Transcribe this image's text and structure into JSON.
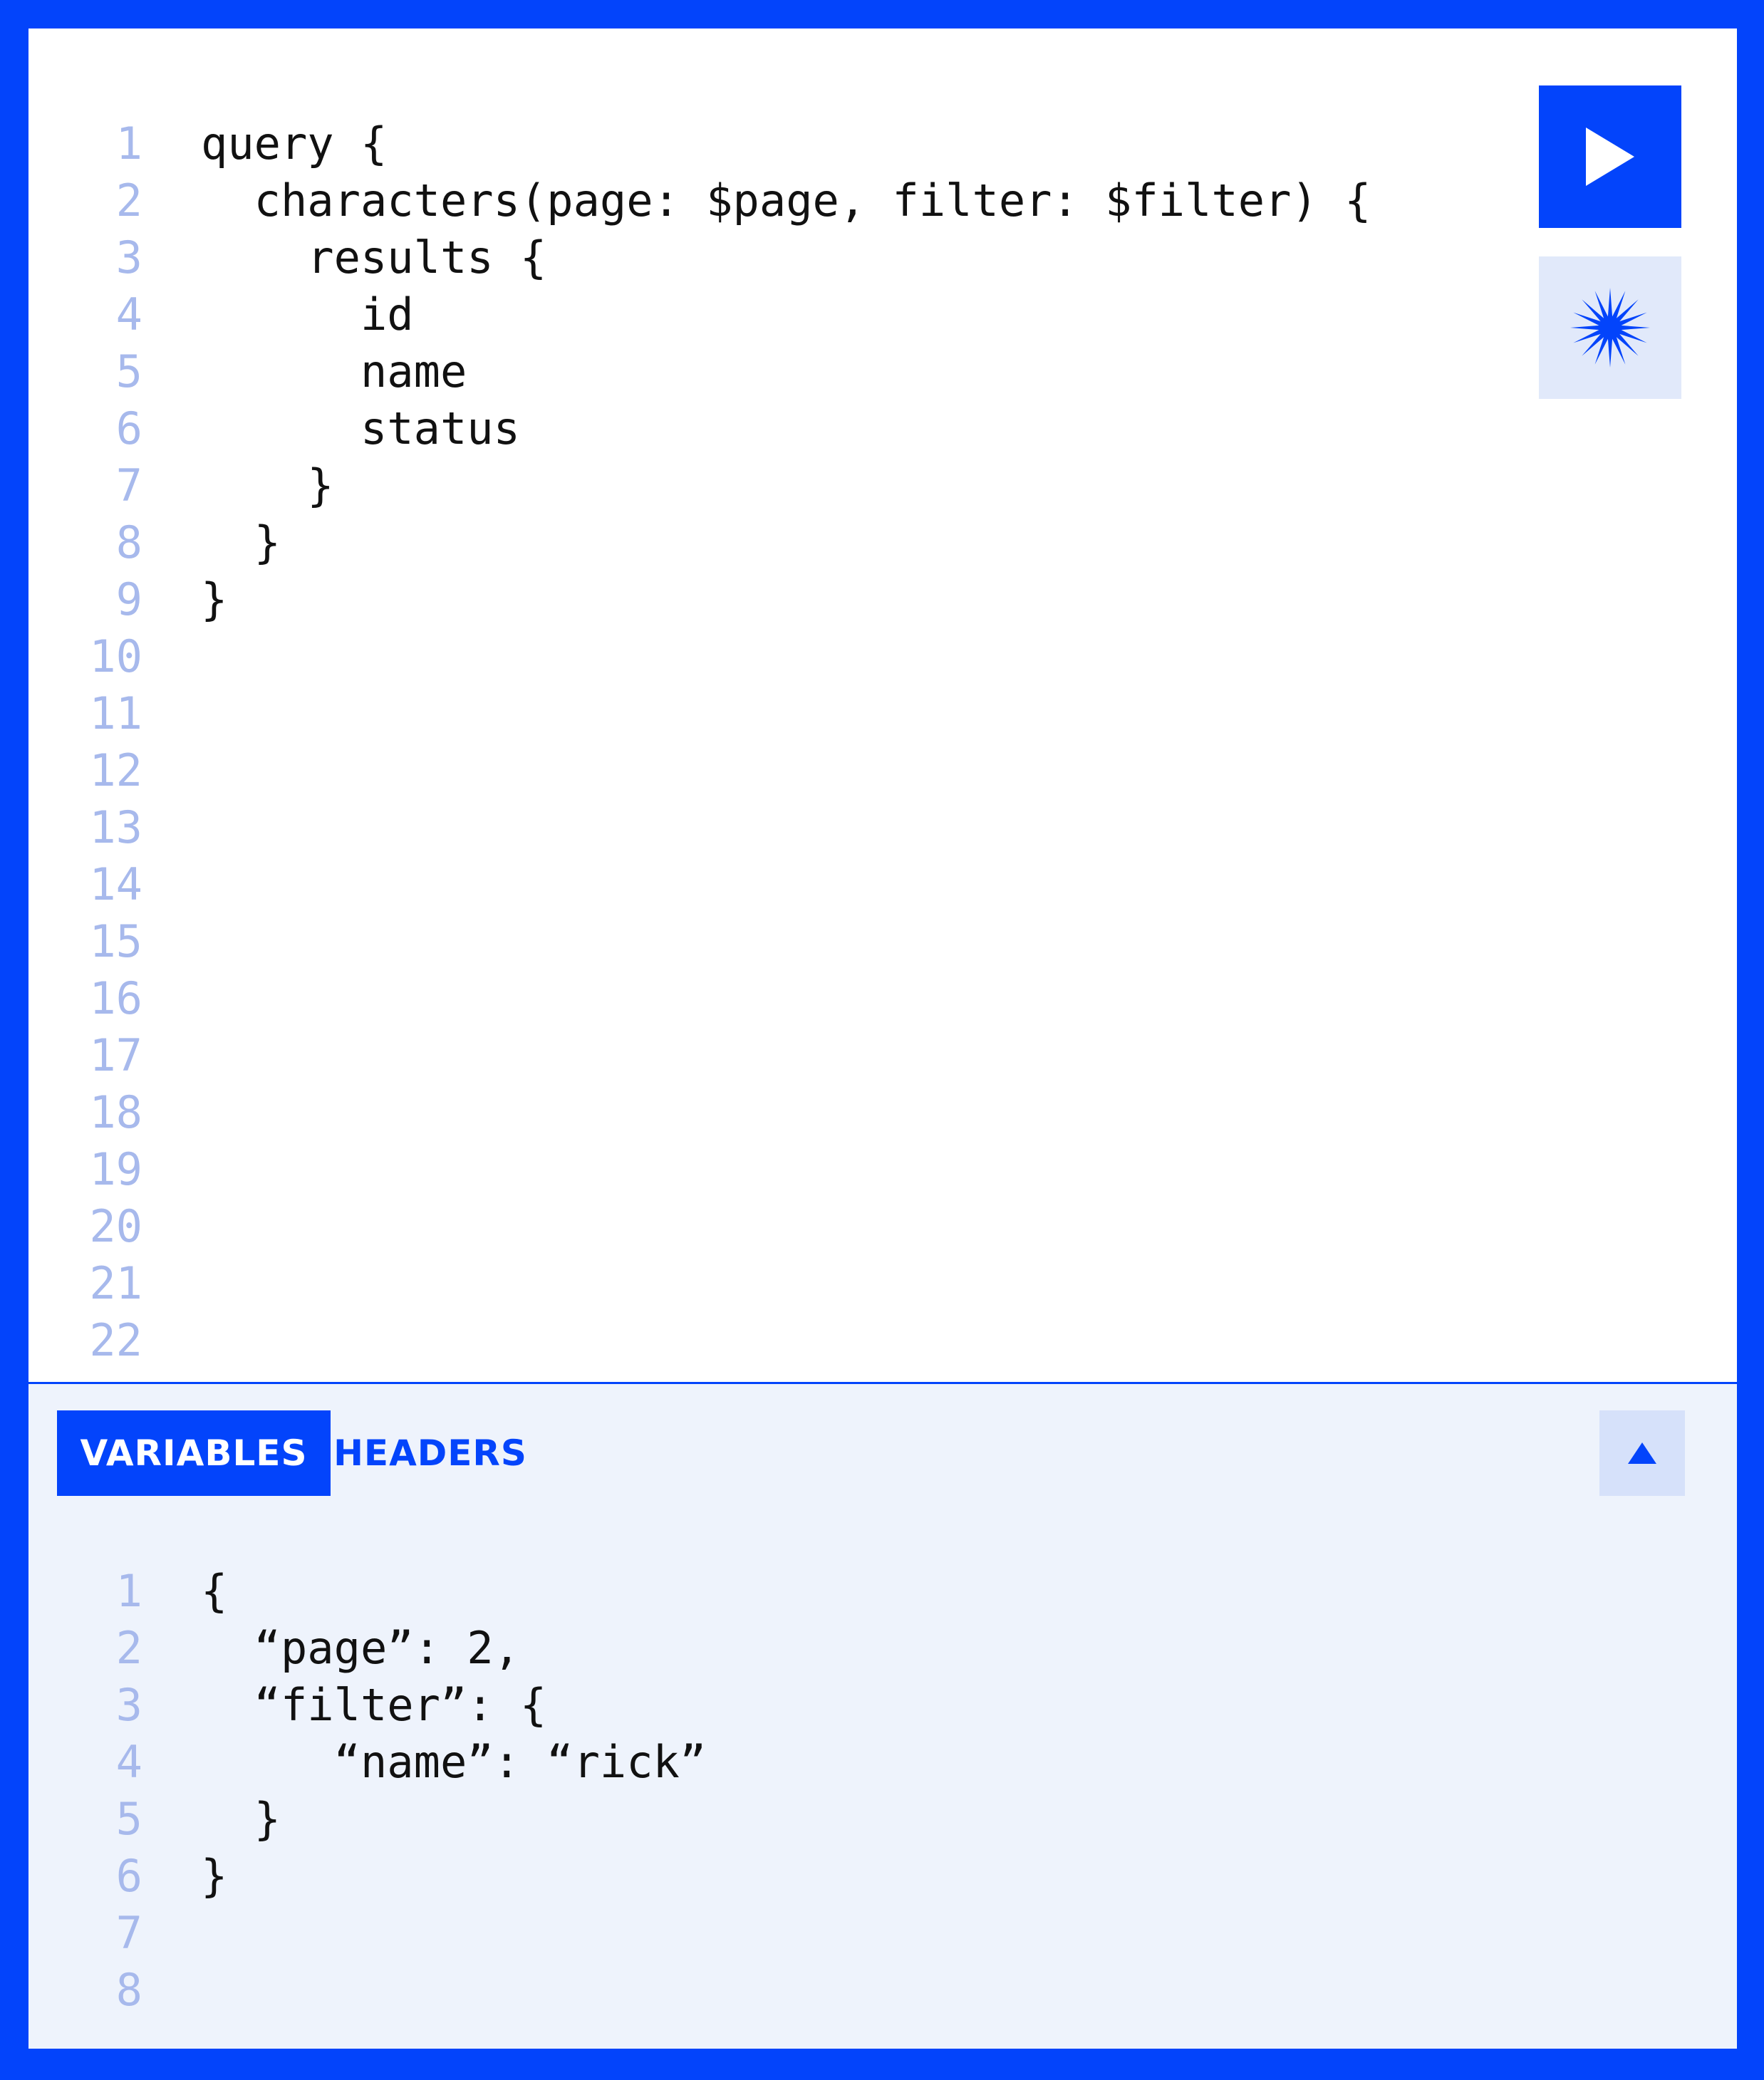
{
  "editor": {
    "lines": [
      {
        "n": "1",
        "code": "query {"
      },
      {
        "n": "2",
        "code": "  characters(page: $page, filter: $filter) {"
      },
      {
        "n": "3",
        "code": "    results {"
      },
      {
        "n": "4",
        "code": "      id"
      },
      {
        "n": "5",
        "code": "      name"
      },
      {
        "n": "6",
        "code": "      status"
      },
      {
        "n": "7",
        "code": "    }"
      },
      {
        "n": "8",
        "code": "  }"
      },
      {
        "n": "9",
        "code": "}"
      },
      {
        "n": "10",
        "code": ""
      },
      {
        "n": "11",
        "code": ""
      },
      {
        "n": "12",
        "code": ""
      },
      {
        "n": "13",
        "code": ""
      },
      {
        "n": "14",
        "code": ""
      },
      {
        "n": "15",
        "code": ""
      },
      {
        "n": "16",
        "code": ""
      },
      {
        "n": "17",
        "code": ""
      },
      {
        "n": "18",
        "code": ""
      },
      {
        "n": "19",
        "code": ""
      },
      {
        "n": "20",
        "code": ""
      },
      {
        "n": "21",
        "code": ""
      },
      {
        "n": "22",
        "code": ""
      }
    ],
    "run_icon": "play-icon",
    "prettify_icon": "sparkle-icon"
  },
  "panel": {
    "tabs": [
      {
        "label": "VARIABLES",
        "active": true
      },
      {
        "label": "HEADERS",
        "active": false
      }
    ],
    "collapse_icon": "triangle-up-icon",
    "lines": [
      {
        "n": "1",
        "code": "{"
      },
      {
        "n": "2",
        "code": "  “page”: 2,"
      },
      {
        "n": "3",
        "code": "  “filter”: {"
      },
      {
        "n": "4",
        "code": "     “name”: “rick”"
      },
      {
        "n": "5",
        "code": "  }"
      },
      {
        "n": "6",
        "code": "}"
      },
      {
        "n": "7",
        "code": ""
      },
      {
        "n": "8",
        "code": ""
      }
    ]
  },
  "colors": {
    "accent": "#0344FB",
    "line_number": "#A7B9EC",
    "panel_bg": "#EEF3FC",
    "button_light": "#E1E9FA"
  }
}
